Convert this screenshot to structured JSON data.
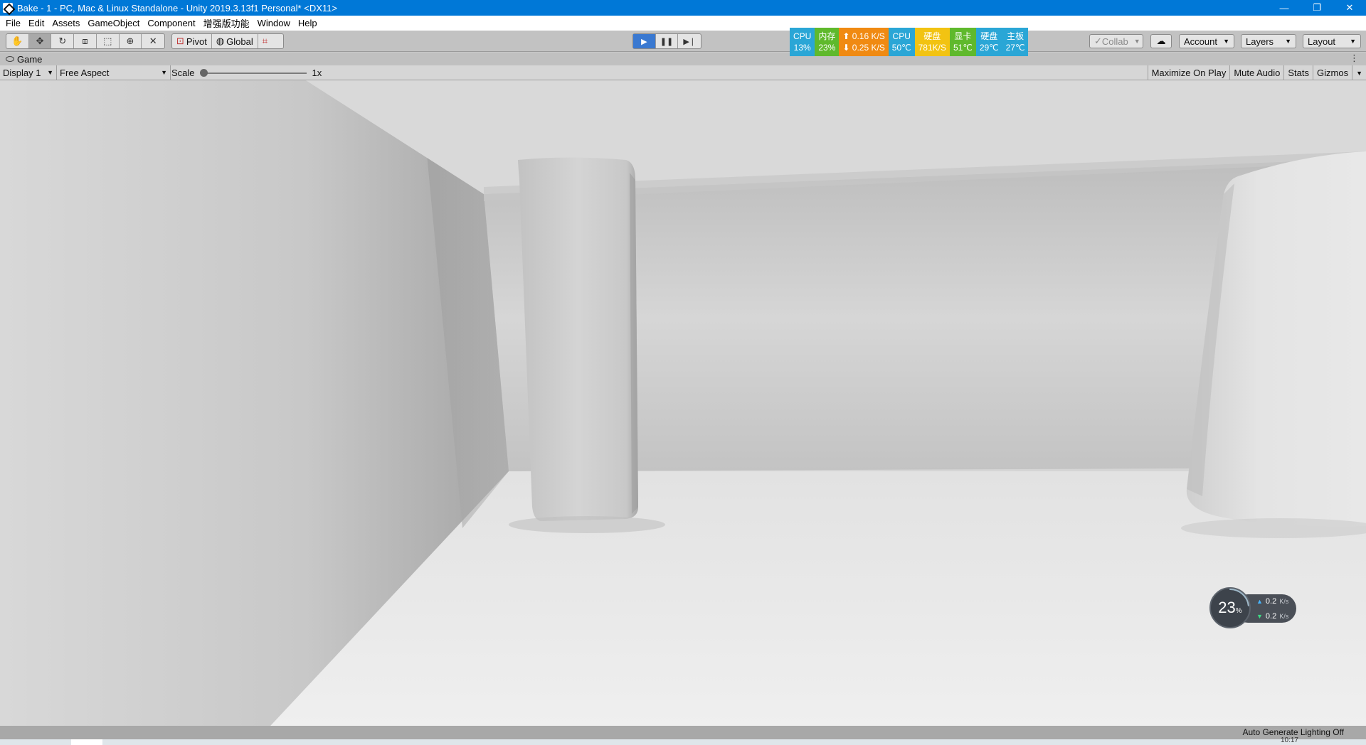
{
  "window": {
    "title": "Bake - 1 - PC, Mac & Linux Standalone - Unity 2019.3.13f1 Personal* <DX11>",
    "controls": [
      "—",
      "❐",
      "✕"
    ]
  },
  "menu": [
    "File",
    "Edit",
    "Assets",
    "GameObject",
    "Component",
    "增强版功能",
    "Window",
    "Help"
  ],
  "toolbar": {
    "tools": [
      "hand-tool-icon",
      "move-tool-icon",
      "rotate-tool-icon",
      "scale-tool-icon",
      "rect-tool-icon",
      "transform-tool-icon",
      "custom-tool-icon"
    ],
    "pivot_label": "Pivot",
    "global_label": "Global",
    "collab_label": "Collab",
    "account_label": "Account",
    "layers_label": "Layers",
    "layout_label": "Layout",
    "play_state": "playing"
  },
  "monitor": [
    {
      "top": "CPU",
      "bottom": "13%",
      "color": "#2aa6d6"
    },
    {
      "top": "内存",
      "bottom": "23%",
      "color": "#5fb92c"
    },
    {
      "top": "⬆ 0.16 K/S",
      "bottom": "⬇ 0.25 K/S",
      "color": "#f08a12"
    },
    {
      "top": "CPU",
      "bottom": "50℃",
      "color": "#2aa6d6"
    },
    {
      "top": "硬盘",
      "bottom": "781K/S",
      "color": "#f2c312"
    },
    {
      "top": "显卡",
      "bottom": "51℃",
      "color": "#5fb92c"
    },
    {
      "top": "硬盘",
      "bottom": "29℃",
      "color": "#2aa6d6"
    },
    {
      "top": "主板",
      "bottom": "27℃",
      "color": "#2aa6d6"
    }
  ],
  "game": {
    "tab_label": "Game",
    "display": "Display 1",
    "aspect": "Free Aspect",
    "scale_label": "Scale",
    "scale_value": "1x",
    "scale_fraction": 0.0,
    "toggles": [
      "Maximize On Play",
      "Mute Audio",
      "Stats",
      "Gizmos"
    ]
  },
  "net_widget": {
    "percent": "23",
    "percent_unit": "%",
    "up_value": "0.2",
    "down_value": "0.2",
    "unit": "K/s",
    "ring_fraction": 0.23
  },
  "status": {
    "lighting": "Auto Generate Lighting Off",
    "clock": "10:17"
  }
}
